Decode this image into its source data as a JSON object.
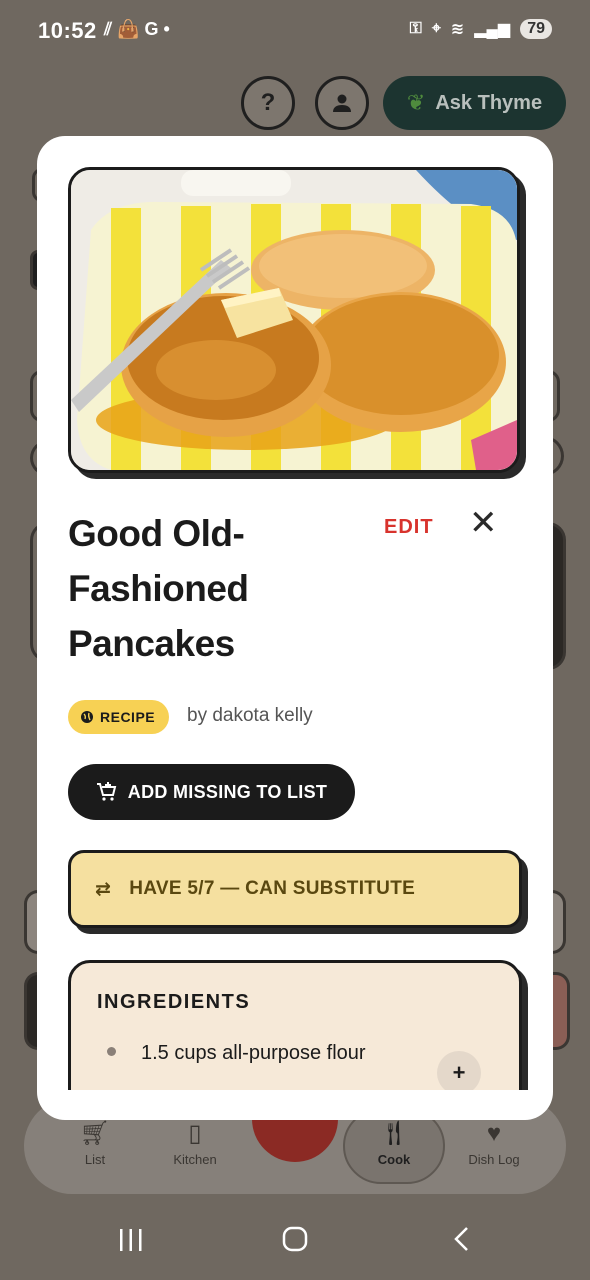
{
  "status_bar": {
    "time": "10:52",
    "battery": "79",
    "left_glyphs": "⫽ 👜 G •"
  },
  "background": {
    "help_label": "?",
    "ask_button_label": "Ask Thyme",
    "nav": [
      {
        "label": "List",
        "icon": "cart-icon"
      },
      {
        "label": "Kitchen",
        "icon": "fridge-icon"
      },
      {
        "label": "Cook",
        "icon": "utensils-icon"
      },
      {
        "label": "Dish Log",
        "icon": "heart-icon"
      }
    ]
  },
  "modal": {
    "title": "Good Old-Fashioned Pancakes",
    "edit_label": "EDIT",
    "close_label": "✕",
    "badge_label": "RECIPE",
    "author": "by dakota kelly",
    "add_missing_label": "ADD MISSING TO LIST",
    "have_label": "HAVE 5/7 — CAN SUBSTITUTE",
    "ingredients_title": "INGREDIENTS",
    "ingredients": [
      {
        "text": "1.5 cups all-purpose flour",
        "add_label": "+"
      }
    ]
  },
  "colors": {
    "accent_red": "#d8332d",
    "badge_yellow": "#f7d154",
    "have_bg": "#f5e0a0",
    "ingredients_bg": "#f6e9d8"
  }
}
